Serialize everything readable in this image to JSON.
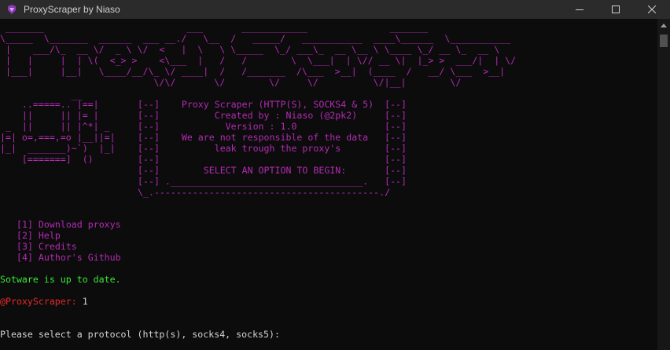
{
  "window": {
    "title": "ProxyScraper by Niaso",
    "minimize_icon": "minimize-icon",
    "maximize_icon": "maximize-icon",
    "close_icon": "close-icon"
  },
  "colors": {
    "background": "#0c0c0c",
    "accent_purple": "#b32bb3",
    "success_green": "#3ae63a",
    "prompt_red": "#e52a2a"
  },
  "banner": {
    "lines": [
      " _______                          ___       ____________               _______",
      "\\_____  \\_______  ______  ___ __./   \\__  /   _____/   ___________  ____\\______  \\___________",
      " |    ___/\\_  __ \\/  _ \\ \\/  <   |  \\   \\ \\_____  \\_/ ___\\_  __ \\__ \\ \\____ \\_/ __ \\_  __ \\",
      " |   |     |  | \\(  <_> >    <\\___  |   /   /        \\  \\___|  | \\// __ \\|  |_> >  ___/|  | \\/",
      " |___|     |__|   \\____/__/\\_ \\/ ____|  /   /_______  /\\___  >__|  (____  /   __/ \\___  >__|",
      "                            \\/\\/       \\/        \\/     \\/          \\/|__|        \\/"
    ]
  },
  "art": {
    "lines": [
      "             __",
      "    ..=====.. |==|",
      "    ||     || |= |",
      " _  ||     || |^*| _",
      "|=| o=,===,=o |__||=|",
      "|_|  _______)~`)  |_|",
      "    [=======]  ()"
    ]
  },
  "info_box": {
    "lines": [
      "[--]    Proxy Scraper (HTTP(S), SOCKS4 & 5)  [--]",
      "[--]          Created by : Niaso (@2pk2)     [--]",
      "[--]            Version : 1.0                [--]",
      "[--]    We are not responsible of the data   [--]",
      "[--]          leak trough the proxy's        [--]",
      "[--]                                         [--]",
      "[--]        SELECT AN OPTION TO BEGIN:       [--]",
      "[--] .___________________________________.   [--]",
      "\\_.-----------------------------------------./"
    ]
  },
  "menu": {
    "items": [
      "[1] Download proxys",
      "[2] Help",
      "[3] Credits",
      "[4] Author's Github"
    ]
  },
  "status": {
    "update_message": "Sotware is up to date."
  },
  "prompt": {
    "label": "@ProxyScraper:",
    "input": "1"
  },
  "question": {
    "text": "Please select a protocol (http(s), socks4, socks5):"
  }
}
